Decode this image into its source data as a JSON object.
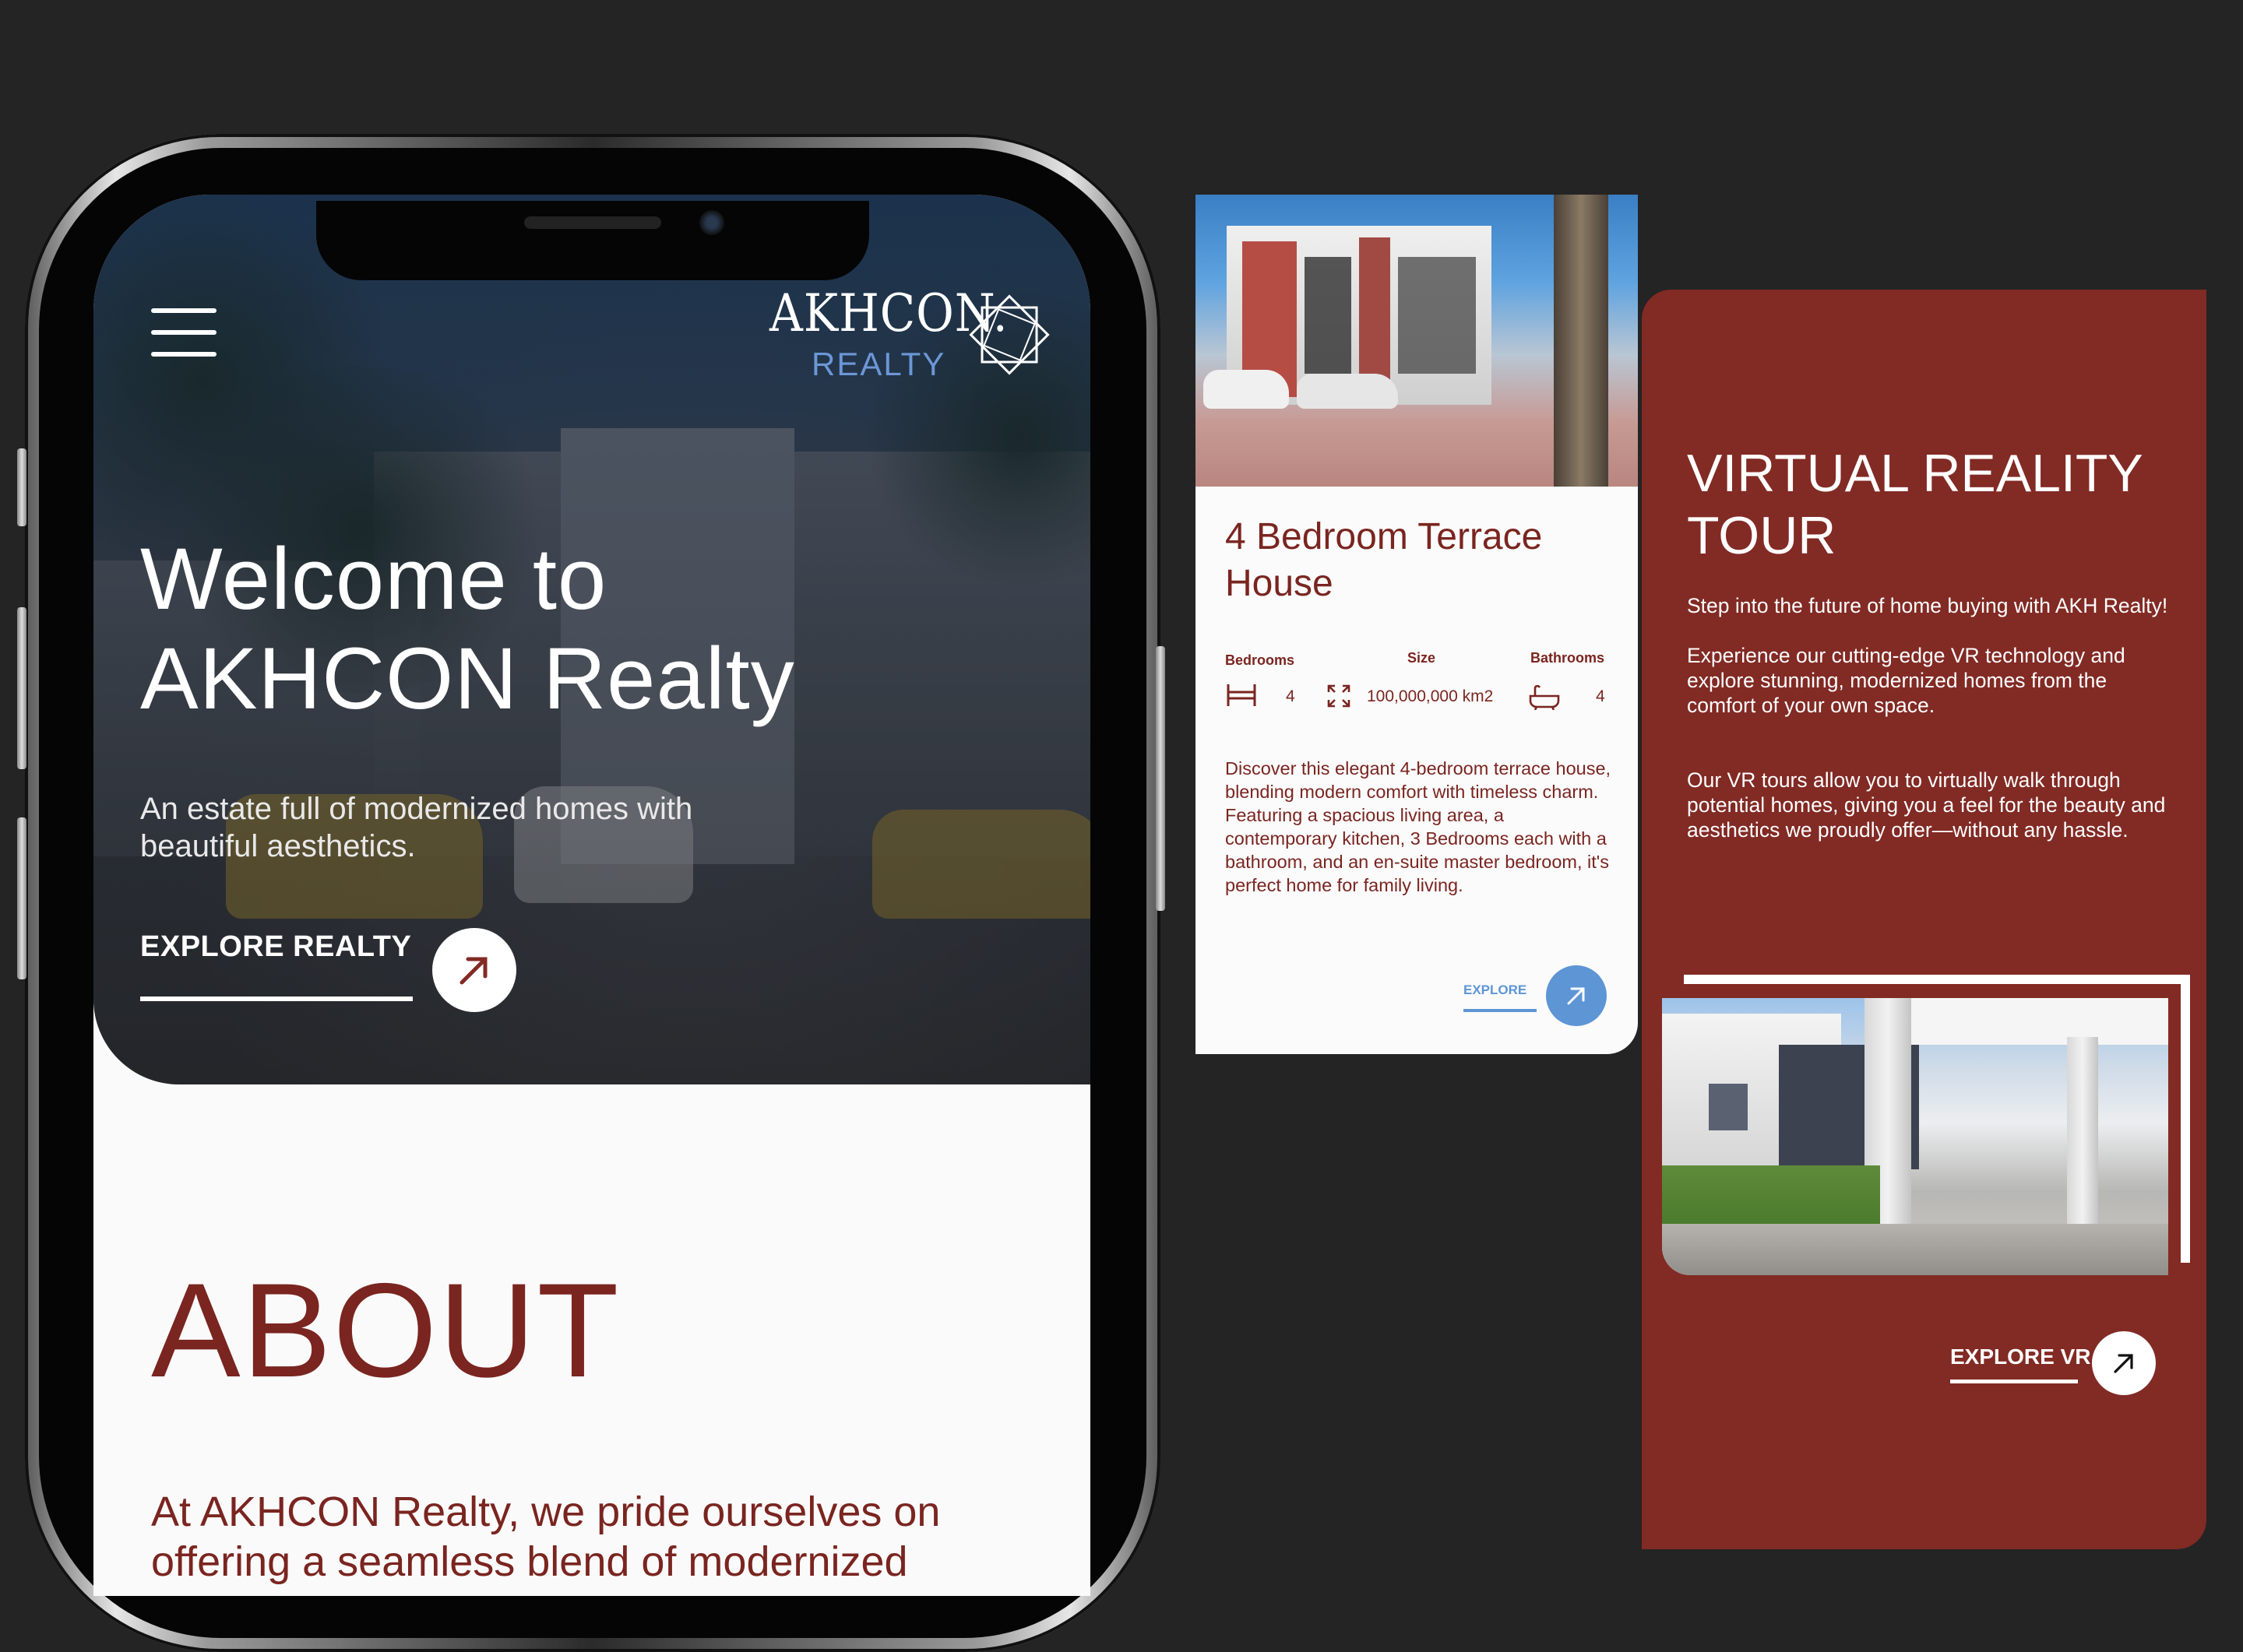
{
  "brand": {
    "logo_main": "AKHCON.",
    "logo_sub": "REALTY"
  },
  "hero": {
    "title_line1": "Welcome to",
    "title_line2": "AKHCON Realty",
    "subtitle_line1": "An estate full of modernized homes with",
    "subtitle_line2": "beautiful aesthetics.",
    "cta_label": "EXPLORE REALTY"
  },
  "about": {
    "title": "ABOUT",
    "text_line1": "At AKHCON Realty, we pride ourselves on",
    "text_line2": "offering a seamless blend of modernized"
  },
  "property_card": {
    "title": "4 Bedroom Terrace House",
    "specs": {
      "bedrooms_label": "Bedrooms",
      "bedrooms_value": "4",
      "size_label": "Size",
      "size_value": "100,000,000 km2",
      "bathrooms_label": "Bathrooms",
      "bathrooms_value": "4"
    },
    "description": "Discover this elegant 4-bedroom terrace house, blending modern comfort with timeless charm. Featuring a spacious living area, a contemporary kitchen, 3 Bedrooms each with a bathroom, and an en-suite master bedroom, it's perfect home for family living.",
    "cta_label": "EXPLORE"
  },
  "vr_tour": {
    "title": "VIRTUAL REALITY TOUR",
    "paragraph1": "Step into the future of home buying with AKH Realty!",
    "paragraph2": "Experience our cutting-edge VR technology and explore stunning, modernized homes from the comfort of your own space.",
    "paragraph3": "Our VR tours allow you to virtually walk through potential homes, giving you a feel for the beauty and aesthetics we proudly offer—without any hassle.",
    "cta_label": "EXPLORE VR"
  },
  "colors": {
    "background": "#242424",
    "brand_red": "#822a24",
    "accent_blue": "#5d95d5",
    "text_red": "#7a2520"
  }
}
